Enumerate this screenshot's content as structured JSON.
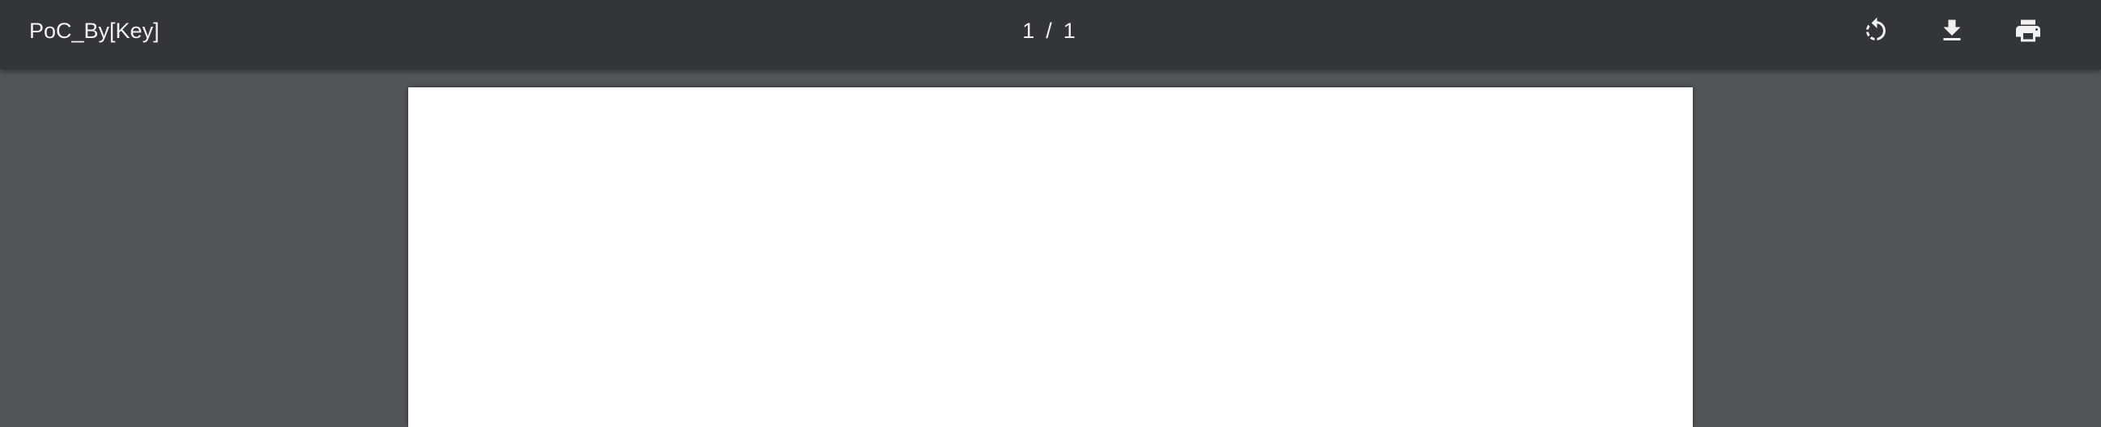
{
  "toolbar": {
    "title": "PoC_By[Key]",
    "page_current": "1",
    "page_separator": "/",
    "page_total": "1",
    "buttons": [
      {
        "name": "rotate",
        "icon": "rotate-icon"
      },
      {
        "name": "download",
        "icon": "download-icon"
      },
      {
        "name": "print",
        "icon": "print-icon"
      }
    ]
  },
  "colors": {
    "toolbar_bg": "#323639",
    "viewer_bg": "#525659",
    "page_bg": "#ffffff",
    "text": "#f1f1f1"
  }
}
